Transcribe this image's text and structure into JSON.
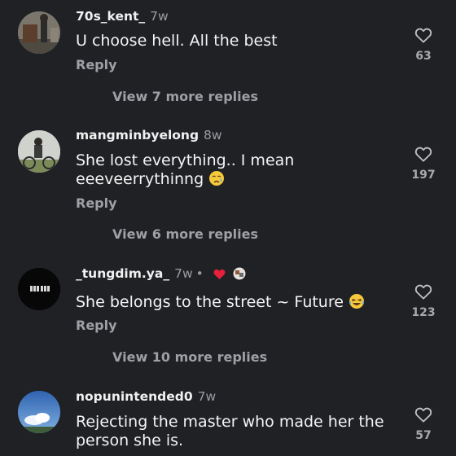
{
  "comments": [
    {
      "username": "70s_kent_",
      "age": "7w",
      "text": "U choose hell. All the best",
      "reply": "Reply",
      "likes": "63",
      "view_more": "View 7 more replies",
      "avatar": "person-standing-photo"
    },
    {
      "username": "mangminbyelong",
      "age": "8w",
      "text": "She lost everything.. I mean eeeveerrythinng",
      "emoji": "crying-face",
      "reply": "Reply",
      "likes": "197",
      "view_more": "View 6 more replies",
      "avatar": "person-on-bike-photo"
    },
    {
      "username": "_tungdim.ya_",
      "age": "7w",
      "text": "She belongs to the street ~ Future",
      "emoji": "laughing-face",
      "reply": "Reply",
      "likes": "123",
      "view_more": "View 10 more replies",
      "avatar": "black-logo-avatar",
      "badges": [
        "red-heart",
        "creator-avatar"
      ]
    },
    {
      "username": "nopunintended0",
      "age": "7w",
      "text": "Rejecting the master who made her the person she is.",
      "likes": "57",
      "avatar": "blue-sky-photo"
    }
  ],
  "colors": {
    "background": "#1f2125",
    "secondary_text": "#9ea0a5",
    "heart_badge": "#e5213c"
  }
}
